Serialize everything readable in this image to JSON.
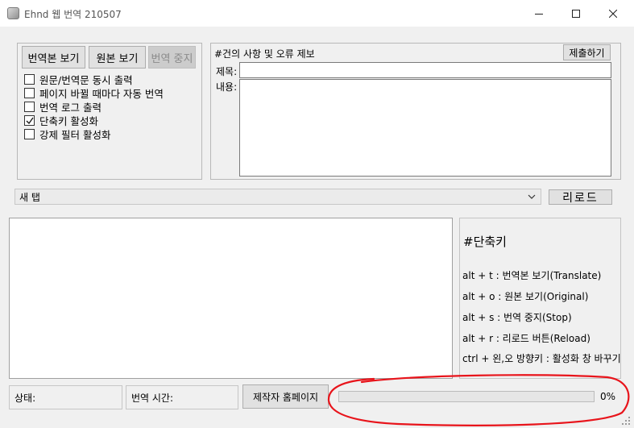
{
  "window": {
    "title": "Ehnd 웹 번역 210507",
    "icon": "app-icon"
  },
  "options": {
    "buttons": {
      "show_translation": "번역본 보기",
      "show_original": "원본 보기",
      "stop_translation": "번역 중지"
    },
    "checkboxes": [
      {
        "label": "원문/번역문 동시 출력",
        "checked": false
      },
      {
        "label": "페이지 바뀔 때마다 자동 번역",
        "checked": false
      },
      {
        "label": "번역 로그 출력",
        "checked": false
      },
      {
        "label": "단축키 활성화",
        "checked": true
      },
      {
        "label": "강제 필터 활성화",
        "checked": false
      }
    ]
  },
  "feedback": {
    "title": "#건의 사항 및 오류 제보",
    "submit_label": "제출하기",
    "subject_label": "제목:",
    "subject_value": "",
    "content_label": "내용:",
    "content_value": ""
  },
  "tabbar": {
    "selected": "새 탭",
    "reload_label": "리로드"
  },
  "shortcuts": {
    "heading": "#단축키",
    "items": [
      "alt + t : 번역본 보기(Translate)",
      "alt + o : 원본 보기(Original)",
      "alt + s : 번역 중지(Stop)",
      "alt + r : 리로드 버튼(Reload)",
      "ctrl + 왼,오 방향키 : 활성화 창 바꾸기"
    ]
  },
  "statusbar": {
    "status_label": "상태:",
    "time_label": "번역 시간:",
    "homepage_label": "제작자 홈페이지",
    "progress_percent": 0,
    "progress_text": "0%"
  },
  "colors": {
    "annotation": "#e8141b",
    "progress_fill": "#06b025"
  }
}
